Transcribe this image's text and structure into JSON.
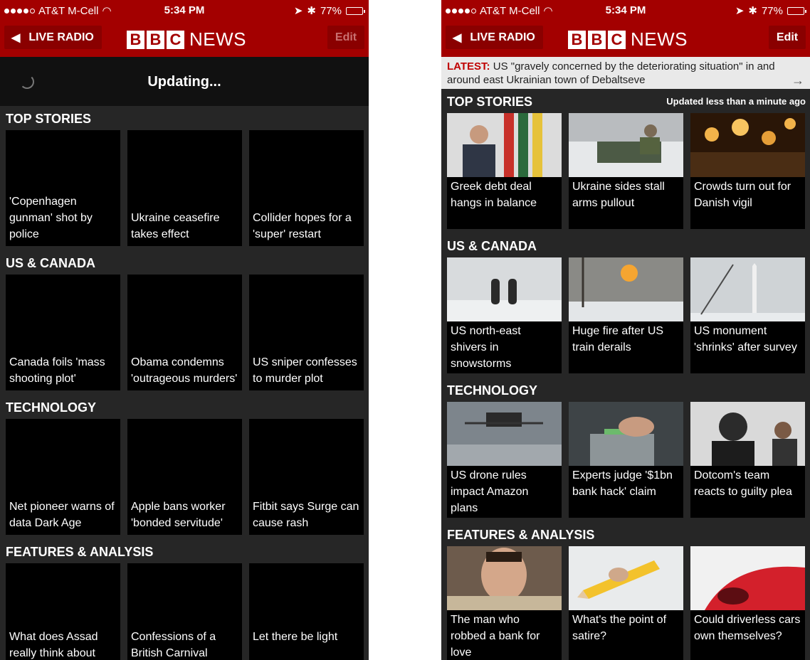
{
  "status": {
    "carrier": "AT&T M-Cell",
    "time": "5:34 PM",
    "battery": "77%",
    "battery_level": 0.77
  },
  "nav": {
    "radio_label": "LIVE RADIO",
    "logo_letters": [
      "B",
      "B",
      "C"
    ],
    "logo_word": "NEWS",
    "edit_label": "Edit"
  },
  "left": {
    "updating_label": "Updating...",
    "sections": [
      {
        "title": "TOP STORIES",
        "cards": [
          "'Copenhagen gunman' shot by police",
          "Ukraine ceasefire takes effect",
          "Collider hopes for a 'super' restart"
        ]
      },
      {
        "title": "US & CANADA",
        "cards": [
          "Canada foils 'mass shooting plot'",
          "Obama condemns 'outrageous murders'",
          "US sniper confesses to murder plot"
        ]
      },
      {
        "title": "TECHNOLOGY",
        "cards": [
          "Net pioneer warns of data Dark Age",
          "Apple bans worker 'bonded servitude'",
          "Fitbit says Surge can cause rash"
        ]
      },
      {
        "title": "FEATURES & ANALYSIS",
        "cards": [
          "What does Assad really think about",
          "Confessions of a British Carnival",
          "Let there be light"
        ]
      }
    ]
  },
  "right": {
    "latest_tag": "LATEST:",
    "latest_text": "US \"gravely concerned by the deteriorating situation\" in and around east Ukrainian town of Debaltseve",
    "updated_note": "Updated less than a minute ago",
    "sections": [
      {
        "title": "TOP STORIES",
        "cards": [
          "Greek debt deal hangs in balance",
          "Ukraine sides stall arms pullout",
          "Crowds turn out for Danish vigil"
        ]
      },
      {
        "title": "US & CANADA",
        "cards": [
          "US north-east shivers in snowstorms",
          "Huge fire after US train derails",
          "US monument 'shrinks' after survey"
        ]
      },
      {
        "title": "TECHNOLOGY",
        "cards": [
          "US drone rules impact Amazon plans",
          "Experts judge '$1bn bank hack' claim",
          "Dotcom's team reacts to guilty plea"
        ]
      },
      {
        "title": "FEATURES & ANALYSIS",
        "cards": [
          "The man who robbed a bank for love",
          "What's the point of satire?",
          "Could driverless cars own themselves?"
        ]
      }
    ]
  },
  "colors": {
    "bbc_red": "#a30000",
    "background": "#262626",
    "latest_red": "#c00000"
  }
}
